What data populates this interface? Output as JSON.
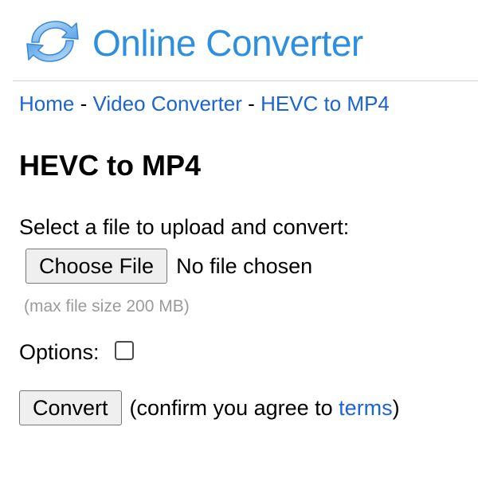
{
  "header": {
    "logo_icon": "refresh-arrows-icon",
    "site_title": "Online Converter"
  },
  "breadcrumb": {
    "items": [
      {
        "label": "Home"
      },
      {
        "label": "Video Converter"
      },
      {
        "label": "HEVC to MP4"
      }
    ],
    "separator": "-"
  },
  "page_title": "HEVC to MP4",
  "upload": {
    "label": "Select a file to upload and convert:",
    "choose_button": "Choose File",
    "status": "No file chosen",
    "max_size_note": "(max file size 200 MB)"
  },
  "options": {
    "label": "Options:",
    "checked": false
  },
  "convert": {
    "button": "Convert",
    "confirm_prefix": "(confirm you agree to ",
    "terms_link": "terms",
    "confirm_suffix": ")"
  },
  "colors": {
    "brand_blue": "#2e8fe0",
    "link_blue": "#1b63d6",
    "muted_gray": "#9a9a9a"
  }
}
